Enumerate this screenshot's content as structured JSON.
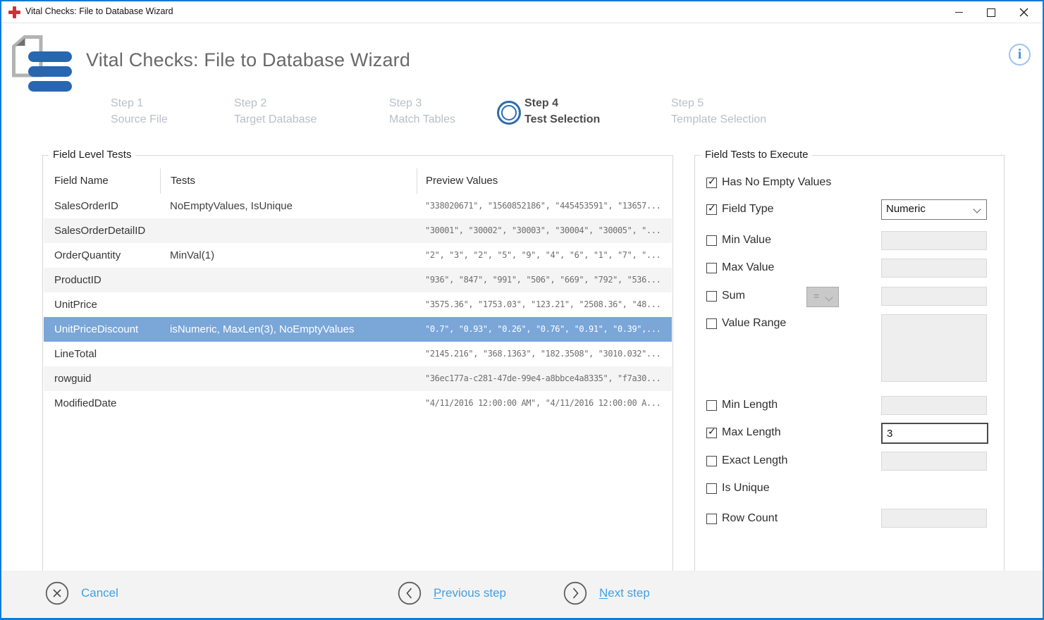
{
  "window": {
    "title": "Vital Checks: File to Database Wizard"
  },
  "header": {
    "title": "Vital Checks: File to Database Wizard",
    "info_glyph": "i"
  },
  "steps": [
    {
      "step": "Step 1",
      "label": "Source File",
      "active": false
    },
    {
      "step": "Step 2",
      "label": "Target Database",
      "active": false
    },
    {
      "step": "Step 3",
      "label": "Match Tables",
      "active": false
    },
    {
      "step": "Step 4",
      "label": "Test Selection",
      "active": true
    },
    {
      "step": "Step 5",
      "label": "Template Selection",
      "active": false
    }
  ],
  "field_level_tests": {
    "group_label": "Field Level Tests",
    "columns": [
      "Field Name",
      "Tests",
      "Preview Values"
    ],
    "rows": [
      {
        "field": "SalesOrderID",
        "tests": "NoEmptyValues, IsUnique",
        "preview": "\"338020671\", \"1560852186\", \"445453591\", \"13657...",
        "selected": false
      },
      {
        "field": "SalesOrderDetailID",
        "tests": "",
        "preview": "\"30001\", \"30002\", \"30003\", \"30004\", \"30005\", \"...",
        "selected": false
      },
      {
        "field": "OrderQuantity",
        "tests": "MinVal(1)",
        "preview": "\"2\", \"3\", \"2\", \"5\", \"9\", \"4\", \"6\", \"1\", \"7\", \"...",
        "selected": false
      },
      {
        "field": "ProductID",
        "tests": "",
        "preview": "\"936\", \"847\", \"991\", \"506\", \"669\", \"792\", \"536...",
        "selected": false
      },
      {
        "field": "UnitPrice",
        "tests": "",
        "preview": "\"3575.36\", \"1753.03\", \"123.21\", \"2508.36\", \"48...",
        "selected": false
      },
      {
        "field": "UnitPriceDiscount",
        "tests": "isNumeric, MaxLen(3), NoEmptyValues",
        "preview": "\"0.7\", \"0.93\", \"0.26\", \"0.76\", \"0.91\", \"0.39\",...",
        "selected": true
      },
      {
        "field": "LineTotal",
        "tests": "",
        "preview": "\"2145.216\", \"368.1363\", \"182.3508\", \"3010.032\"...",
        "selected": false
      },
      {
        "field": "rowguid",
        "tests": "",
        "preview": "\"36ec177a-c281-47de-99e4-a8bbce4a8335\", \"f7a30...",
        "selected": false
      },
      {
        "field": "ModifiedDate",
        "tests": "",
        "preview": "\"4/11/2016 12:00:00 AM\", \"4/11/2016 12:00:00 A...",
        "selected": false
      }
    ]
  },
  "field_tests_panel": {
    "group_label": "Field Tests to Execute",
    "items": [
      {
        "label": "Has No Empty Values",
        "check": "✓"
      },
      {
        "label": "Field Type",
        "check": "✓",
        "value": "Numeric"
      },
      {
        "label": "Min Value",
        "check": ""
      },
      {
        "label": "Max Value",
        "check": ""
      },
      {
        "label": "Sum",
        "check": "",
        "operator": "="
      },
      {
        "label": "Value Range",
        "check": ""
      },
      {
        "label": "Min Length",
        "check": ""
      },
      {
        "label": "Max Length",
        "check": "✓",
        "value": "3"
      },
      {
        "label": "Exact Length",
        "check": ""
      },
      {
        "label": "Is Unique",
        "check": ""
      },
      {
        "label": "Row Count",
        "check": ""
      }
    ]
  },
  "footer": {
    "cancel": {
      "label": "Cancel"
    },
    "previous": {
      "initial": "P",
      "rest": "revious step"
    },
    "next": {
      "initial": "N",
      "rest": "ext step"
    }
  },
  "colors": {
    "accent_border": "#0f7bd7",
    "selected_row": "#7aa6d8",
    "link_blue": "#42a0e4",
    "step_circle_blue": "#2b6cb0",
    "logo_blue": "#2767b1",
    "cross_red": "#cd3232"
  }
}
